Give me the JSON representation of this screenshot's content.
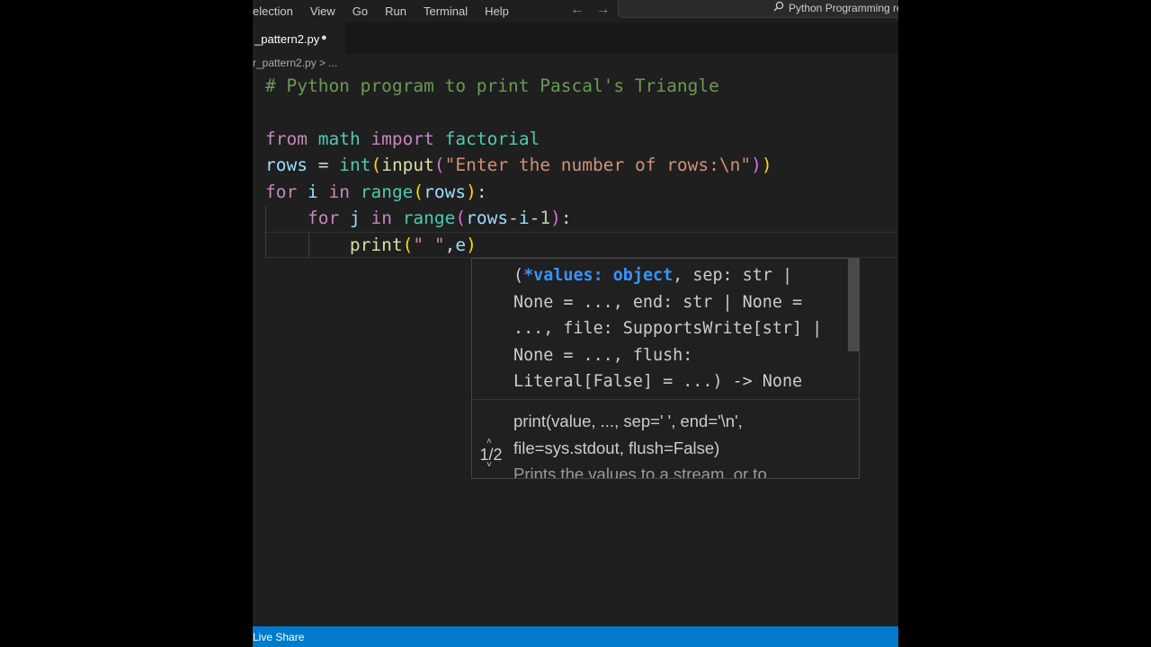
{
  "menubar": {
    "items": [
      "election",
      "View",
      "Go",
      "Run",
      "Terminal",
      "Help"
    ],
    "back_arrow": "←",
    "forward_arrow": "→",
    "search_text": "Python Programming re"
  },
  "tab": {
    "label": "_pattern2.py",
    "modified_dot": "●"
  },
  "breadcrumb": "r_pattern2.py > ...",
  "code": {
    "line1_comment": "# Python program to print Pascal's Triangle",
    "line3": {
      "kw1": "from",
      "mod": "math",
      "kw2": "import",
      "name": "factorial"
    },
    "line4": {
      "var": "rows",
      "eq": "=",
      "fn1": "int",
      "p1": "(",
      "fn2": "input",
      "p2": "(",
      "str": "\"Enter the number of rows:\\n\"",
      "p3": ")",
      "p4": ")"
    },
    "line5": {
      "kw1": "for",
      "var": "i",
      "kw2": "in",
      "fn": "range",
      "p1": "(",
      "arg": "rows",
      "p2": ")",
      "colon": ":"
    },
    "line6": {
      "kw1": "for",
      "var": "j",
      "kw2": "in",
      "fn": "range",
      "p1": "(",
      "a1": "rows",
      "m1": "-",
      "a2": "i",
      "m2": "-",
      "num": "1",
      "p2": ")",
      "colon": ":"
    },
    "line7": {
      "fn": "print",
      "p1": "(",
      "str": "\" \"",
      "comma": ",",
      "arg": "e",
      "p2": ")"
    }
  },
  "signature_help": {
    "open_paren": "(",
    "active_param": "*values: object",
    "line1_rest": ", sep: str |",
    "line2": "None = ..., end: str | None =",
    "line3": "..., file: SupportsWrite[str] |",
    "line4": "None = ..., flush:",
    "line5": "Literal[False] = ...) -> None",
    "doc_line1": "print(value, ..., sep=' ', end='\\n',",
    "doc_line2": "file=sys.stdout, flush=False)",
    "doc_line3": "Prints the values to a stream, or to",
    "counter": "1/2"
  },
  "statusbar": {
    "live_share": "Live Share"
  }
}
